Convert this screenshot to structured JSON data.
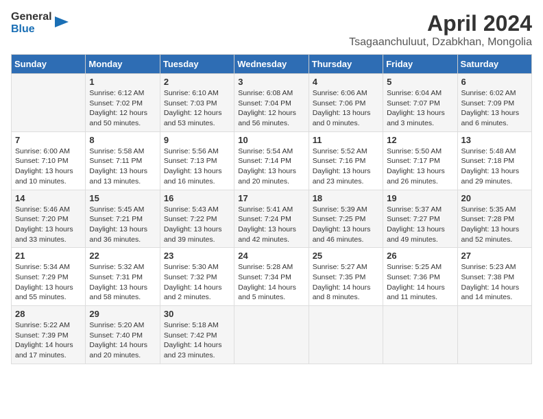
{
  "logo": {
    "general": "General",
    "blue": "Blue"
  },
  "title": "April 2024",
  "subtitle": "Tsagaanchuluut, Dzabkhan, Mongolia",
  "days_of_week": [
    "Sunday",
    "Monday",
    "Tuesday",
    "Wednesday",
    "Thursday",
    "Friday",
    "Saturday"
  ],
  "weeks": [
    [
      {
        "day": "",
        "info": ""
      },
      {
        "day": "1",
        "info": "Sunrise: 6:12 AM\nSunset: 7:02 PM\nDaylight: 12 hours\nand 50 minutes."
      },
      {
        "day": "2",
        "info": "Sunrise: 6:10 AM\nSunset: 7:03 PM\nDaylight: 12 hours\nand 53 minutes."
      },
      {
        "day": "3",
        "info": "Sunrise: 6:08 AM\nSunset: 7:04 PM\nDaylight: 12 hours\nand 56 minutes."
      },
      {
        "day": "4",
        "info": "Sunrise: 6:06 AM\nSunset: 7:06 PM\nDaylight: 13 hours\nand 0 minutes."
      },
      {
        "day": "5",
        "info": "Sunrise: 6:04 AM\nSunset: 7:07 PM\nDaylight: 13 hours\nand 3 minutes."
      },
      {
        "day": "6",
        "info": "Sunrise: 6:02 AM\nSunset: 7:09 PM\nDaylight: 13 hours\nand 6 minutes."
      }
    ],
    [
      {
        "day": "7",
        "info": "Sunrise: 6:00 AM\nSunset: 7:10 PM\nDaylight: 13 hours\nand 10 minutes."
      },
      {
        "day": "8",
        "info": "Sunrise: 5:58 AM\nSunset: 7:11 PM\nDaylight: 13 hours\nand 13 minutes."
      },
      {
        "day": "9",
        "info": "Sunrise: 5:56 AM\nSunset: 7:13 PM\nDaylight: 13 hours\nand 16 minutes."
      },
      {
        "day": "10",
        "info": "Sunrise: 5:54 AM\nSunset: 7:14 PM\nDaylight: 13 hours\nand 20 minutes."
      },
      {
        "day": "11",
        "info": "Sunrise: 5:52 AM\nSunset: 7:16 PM\nDaylight: 13 hours\nand 23 minutes."
      },
      {
        "day": "12",
        "info": "Sunrise: 5:50 AM\nSunset: 7:17 PM\nDaylight: 13 hours\nand 26 minutes."
      },
      {
        "day": "13",
        "info": "Sunrise: 5:48 AM\nSunset: 7:18 PM\nDaylight: 13 hours\nand 29 minutes."
      }
    ],
    [
      {
        "day": "14",
        "info": "Sunrise: 5:46 AM\nSunset: 7:20 PM\nDaylight: 13 hours\nand 33 minutes."
      },
      {
        "day": "15",
        "info": "Sunrise: 5:45 AM\nSunset: 7:21 PM\nDaylight: 13 hours\nand 36 minutes."
      },
      {
        "day": "16",
        "info": "Sunrise: 5:43 AM\nSunset: 7:22 PM\nDaylight: 13 hours\nand 39 minutes."
      },
      {
        "day": "17",
        "info": "Sunrise: 5:41 AM\nSunset: 7:24 PM\nDaylight: 13 hours\nand 42 minutes."
      },
      {
        "day": "18",
        "info": "Sunrise: 5:39 AM\nSunset: 7:25 PM\nDaylight: 13 hours\nand 46 minutes."
      },
      {
        "day": "19",
        "info": "Sunrise: 5:37 AM\nSunset: 7:27 PM\nDaylight: 13 hours\nand 49 minutes."
      },
      {
        "day": "20",
        "info": "Sunrise: 5:35 AM\nSunset: 7:28 PM\nDaylight: 13 hours\nand 52 minutes."
      }
    ],
    [
      {
        "day": "21",
        "info": "Sunrise: 5:34 AM\nSunset: 7:29 PM\nDaylight: 13 hours\nand 55 minutes."
      },
      {
        "day": "22",
        "info": "Sunrise: 5:32 AM\nSunset: 7:31 PM\nDaylight: 13 hours\nand 58 minutes."
      },
      {
        "day": "23",
        "info": "Sunrise: 5:30 AM\nSunset: 7:32 PM\nDaylight: 14 hours\nand 2 minutes."
      },
      {
        "day": "24",
        "info": "Sunrise: 5:28 AM\nSunset: 7:34 PM\nDaylight: 14 hours\nand 5 minutes."
      },
      {
        "day": "25",
        "info": "Sunrise: 5:27 AM\nSunset: 7:35 PM\nDaylight: 14 hours\nand 8 minutes."
      },
      {
        "day": "26",
        "info": "Sunrise: 5:25 AM\nSunset: 7:36 PM\nDaylight: 14 hours\nand 11 minutes."
      },
      {
        "day": "27",
        "info": "Sunrise: 5:23 AM\nSunset: 7:38 PM\nDaylight: 14 hours\nand 14 minutes."
      }
    ],
    [
      {
        "day": "28",
        "info": "Sunrise: 5:22 AM\nSunset: 7:39 PM\nDaylight: 14 hours\nand 17 minutes."
      },
      {
        "day": "29",
        "info": "Sunrise: 5:20 AM\nSunset: 7:40 PM\nDaylight: 14 hours\nand 20 minutes."
      },
      {
        "day": "30",
        "info": "Sunrise: 5:18 AM\nSunset: 7:42 PM\nDaylight: 14 hours\nand 23 minutes."
      },
      {
        "day": "",
        "info": ""
      },
      {
        "day": "",
        "info": ""
      },
      {
        "day": "",
        "info": ""
      },
      {
        "day": "",
        "info": ""
      }
    ]
  ]
}
